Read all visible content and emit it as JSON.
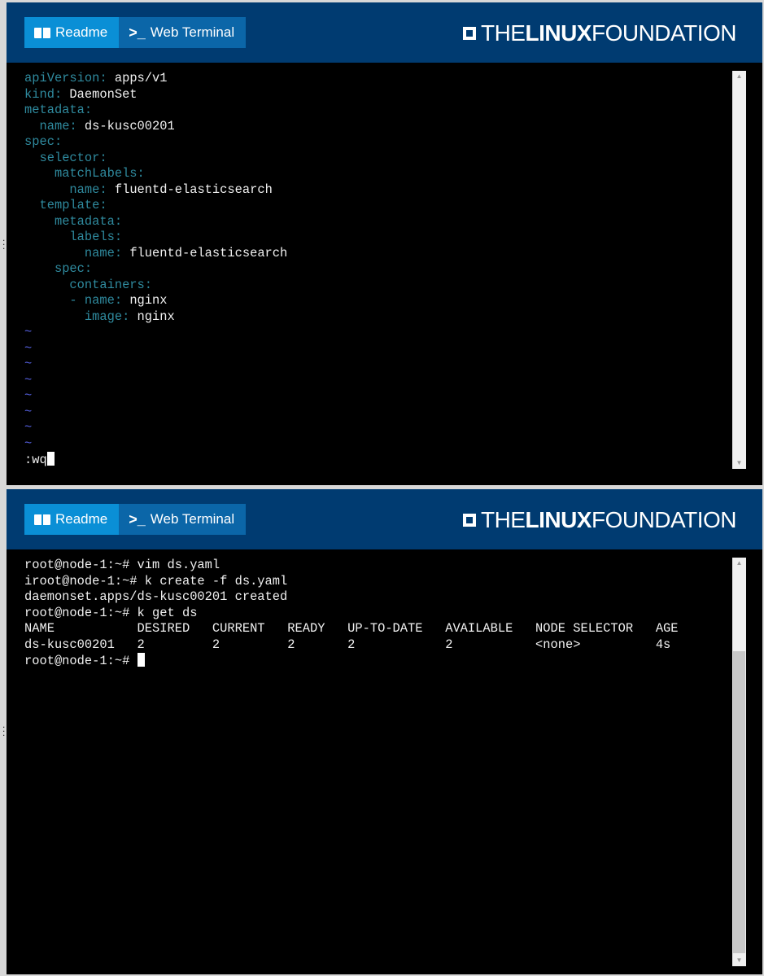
{
  "tabs": {
    "readme": "Readme",
    "terminal": "Web Terminal"
  },
  "logo": {
    "the": "THE",
    "linux": "LINUX",
    "foundation": "FOUNDATION"
  },
  "colors": {
    "header": "#003b71",
    "readme_tab": "#0a8fd6",
    "terminal_tab": "#0b66a8",
    "yaml_key": "#2f8a9e",
    "vim_tilde": "#5560e0"
  },
  "editor": {
    "lines": [
      {
        "indent": "",
        "key": "apiVersion:",
        "value": " apps/v1"
      },
      {
        "indent": "",
        "key": "kind:",
        "value": " DaemonSet"
      },
      {
        "indent": "",
        "key": "metadata:",
        "value": ""
      },
      {
        "indent": "  ",
        "key": "name:",
        "value": " ds-kusc00201"
      },
      {
        "indent": "",
        "key": "spec:",
        "value": ""
      },
      {
        "indent": "  ",
        "key": "selector:",
        "value": ""
      },
      {
        "indent": "    ",
        "key": "matchLabels:",
        "value": ""
      },
      {
        "indent": "      ",
        "key": "name:",
        "value": " fluentd-elasticsearch"
      },
      {
        "indent": "  ",
        "key": "template:",
        "value": ""
      },
      {
        "indent": "    ",
        "key": "metadata:",
        "value": ""
      },
      {
        "indent": "      ",
        "key": "labels:",
        "value": ""
      },
      {
        "indent": "        ",
        "key": "name:",
        "value": " fluentd-elasticsearch"
      },
      {
        "indent": "    ",
        "key": "spec:",
        "value": ""
      },
      {
        "indent": "      ",
        "key": "containers:",
        "value": ""
      },
      {
        "indent": "      ",
        "key": "- name:",
        "value": " nginx"
      },
      {
        "indent": "        ",
        "key": "image:",
        "value": " nginx"
      }
    ],
    "tilde_count": 8,
    "command": ":wq"
  },
  "terminal": {
    "lines": [
      "root@node-1:~# vim ds.yaml",
      "iroot@node-1:~# k create -f ds.yaml",
      "daemonset.apps/ds-kusc00201 created",
      "root@node-1:~# k get ds",
      "NAME           DESIRED   CURRENT   READY   UP-TO-DATE   AVAILABLE   NODE SELECTOR   AGE",
      "ds-kusc00201   2         2         2       2            2           <none>          4s"
    ],
    "prompt": "root@node-1:~# "
  }
}
